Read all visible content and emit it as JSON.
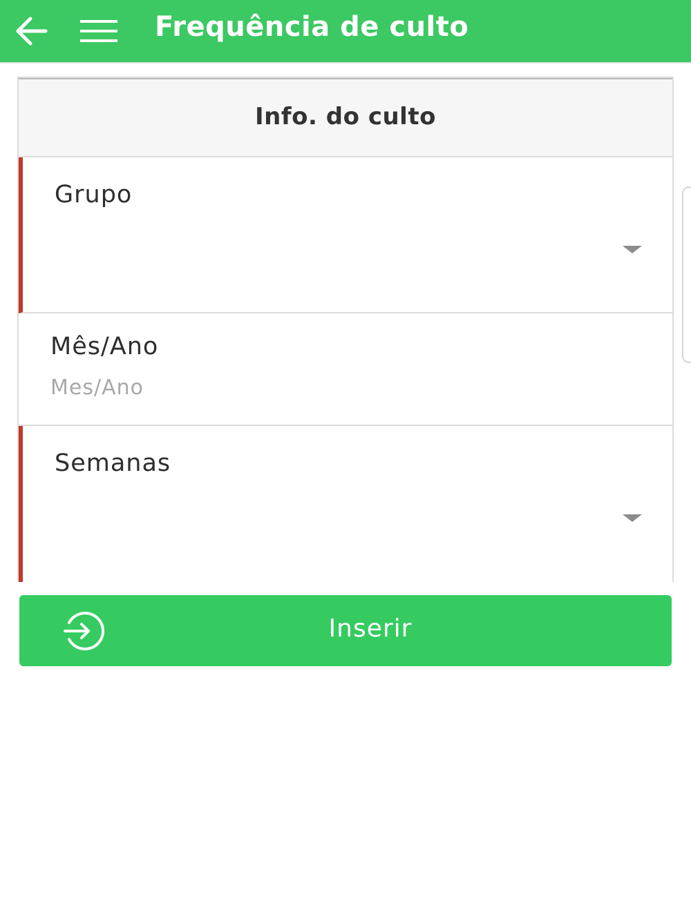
{
  "appbar": {
    "title": "Frequência de culto",
    "back_icon": "arrow-left-icon",
    "menu_icon": "hamburger-menu-icon",
    "color": "#3cc863"
  },
  "card": {
    "header_title": "Info. do culto"
  },
  "fields": {
    "grupo": {
      "label": "Grupo",
      "value": "",
      "required": true
    },
    "mes_ano": {
      "label": "Mês/Ano",
      "placeholder": "Mes/Ano",
      "value": "",
      "required": false
    },
    "semanas": {
      "label": "Semanas",
      "value": "",
      "required": true
    }
  },
  "actions": {
    "inserir_label": "Inserir",
    "inserir_icon": "sign-in-icon",
    "button_color": "#35cb60"
  },
  "colors": {
    "required_marker": "#c0392b"
  }
}
